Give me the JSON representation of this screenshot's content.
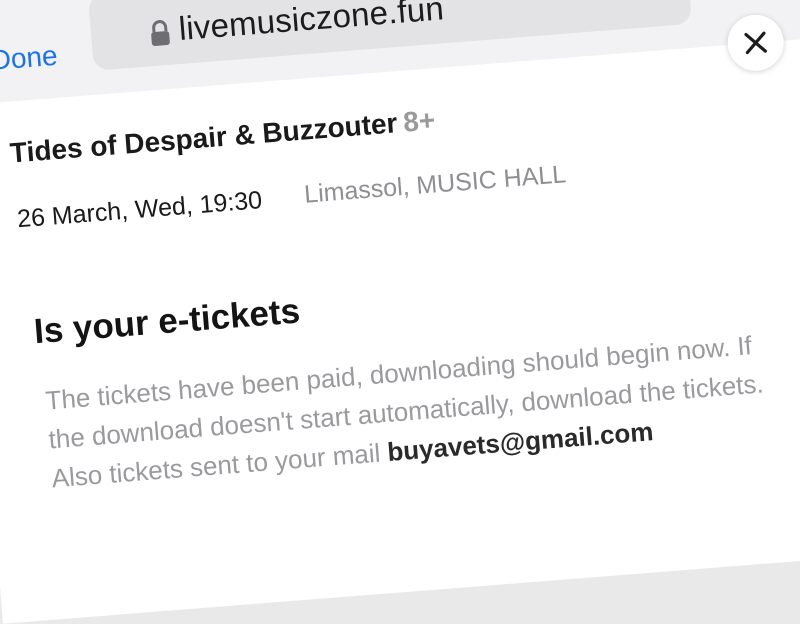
{
  "browser": {
    "done_label": "Done",
    "url": "livemusiczone.fun"
  },
  "event": {
    "title": "Tides of Despair & Buzzouter",
    "age_rating": "8+",
    "datetime": "26 March, Wed, 19:30",
    "venue": "Limassol, MUSIC HALL"
  },
  "message": {
    "heading": "Is your e-tickets",
    "line1": "The tickets have been paid, downloading should begin now. If",
    "line2": "the download doesn't start automatically, download the tickets.",
    "line3_prefix": "Also tickets sent to your mail",
    "email": "buyavets@gmail.com"
  },
  "icons": {
    "lock": "lock-icon",
    "close": "close-icon"
  },
  "colors": {
    "accent": "#1a73e8",
    "muted_text": "#9a9a9e",
    "age_badge": "#9a9a9a"
  }
}
